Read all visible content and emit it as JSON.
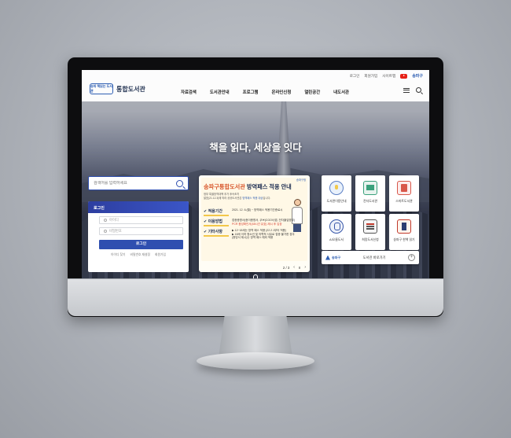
{
  "header": {
    "logo_mark": "송파 책읽는 도서관",
    "title": "통합도서관",
    "utility": [
      "로그인",
      "회원가입",
      "사이트맵"
    ],
    "district_logo": "송파구",
    "nav": [
      "자료검색",
      "도서관안내",
      "프로그램",
      "온라인신청",
      "열린공간",
      "내도서관"
    ]
  },
  "hero": {
    "slogan": "책을 읽다, 세상을 잇다"
  },
  "search": {
    "placeholder": "검색어를 입력하세요"
  },
  "login": {
    "title": "로그인",
    "id_placeholder": "아이디",
    "pw_placeholder": "비밀번호",
    "button": "로그인",
    "links": [
      "아이디 찾기",
      "비밀번호 재설정",
      "회원가입"
    ]
  },
  "notice": {
    "district": "송파구청",
    "title_main": "송파구통합도서관",
    "title_rest": " 방역패스 적용 안내",
    "subtitle_1": "정부 특별방역대책 추가 후속조치",
    "subtitle_2a": "발표(21.12.3)에 따라 공공도서관은 ",
    "subtitle_2b": "방역패스 적용 대상",
    "subtitle_2c": "입니다.",
    "rows": [
      {
        "label": "✔ 적용기간",
        "value": "2021. 12. 6.(월) ~ 방역패스 적용기간종료시"
      },
      {
        "label": "✔ 이용방법",
        "value_1": "접종증명서(종이증명서, 쿠브(COOV)앱, 전자출입명부)",
        "value_2": "PCR 음성확인서(48시간 유효) 제시 후 입장"
      },
      {
        "label": "✔ 기타사항",
        "value_1": "▶ 12~18세는 방역 패스 적용 (22.2.1부터 적용)",
        "value_2": "▶ 18세 이하 청소년 및 의학적 사유로 접종 불가한 경우",
        "value_3": "(증빙서 제시)는 방역 패스 예외 적용"
      }
    ],
    "pager": "2 / 3",
    "pager_pause": "II"
  },
  "tiles": [
    {
      "label": "도서관이용안내",
      "icon": "lightbulb-icon"
    },
    {
      "label": "전자도서관",
      "icon": "ebook-icon"
    },
    {
      "label": "스마트도서관",
      "icon": "smart-library-icon"
    },
    {
      "label": "AI오름도서",
      "icon": "ai-robot-icon"
    },
    {
      "label": "희망도서신청",
      "icon": "request-icon"
    },
    {
      "label": "송파구 한책 읽기",
      "icon": "one-book-icon"
    }
  ],
  "shortcut": {
    "logo": "송파구",
    "label": "도서관 바로가기",
    "plus": "+"
  }
}
